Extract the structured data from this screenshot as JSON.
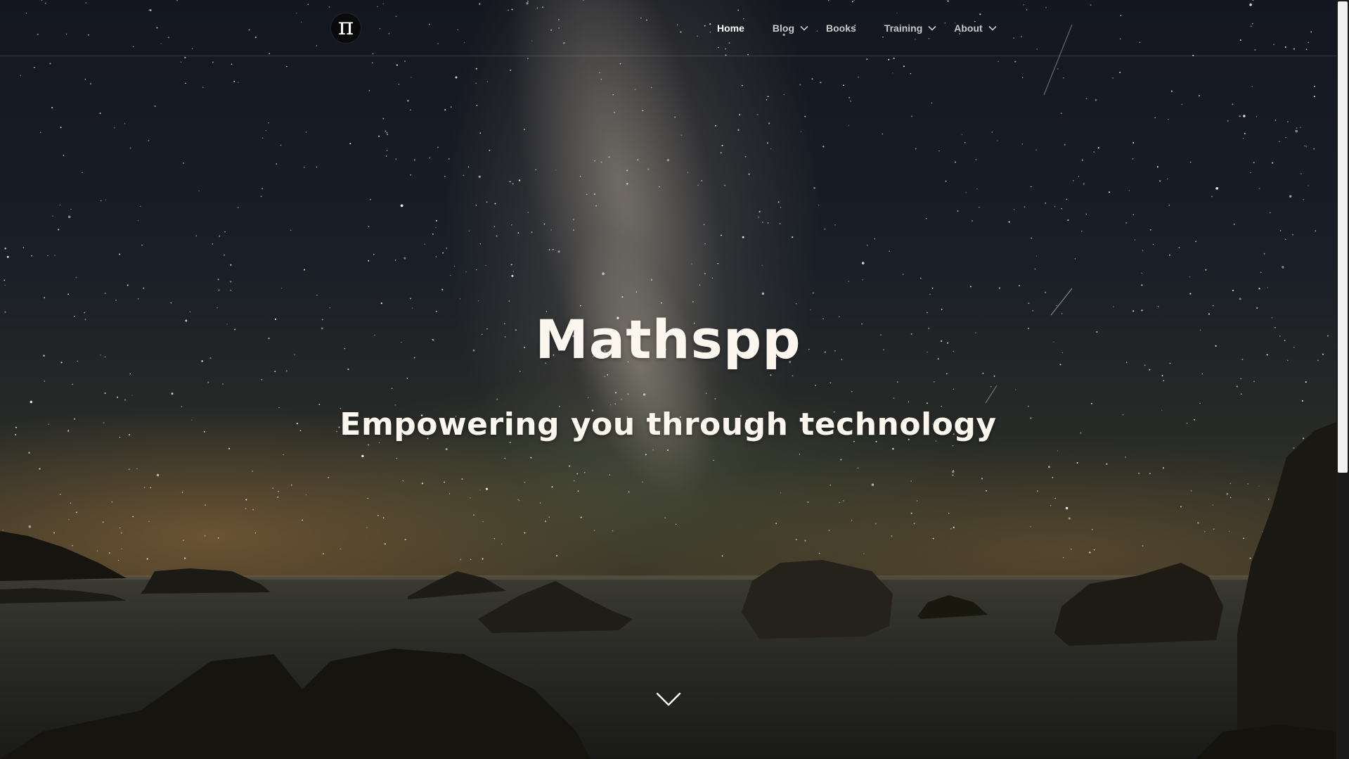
{
  "brand": {
    "logo_glyph": "π",
    "logo_icon": "pi-icon"
  },
  "nav": {
    "items": [
      {
        "label": "Home",
        "active": true,
        "has_dropdown": false
      },
      {
        "label": "Blog",
        "active": false,
        "has_dropdown": true
      },
      {
        "label": "Books",
        "active": false,
        "has_dropdown": false
      },
      {
        "label": "Training",
        "active": false,
        "has_dropdown": true
      },
      {
        "label": "About",
        "active": false,
        "has_dropdown": true
      }
    ]
  },
  "hero": {
    "title": "Mathspp",
    "subtitle": "Empowering you through technology",
    "scroll_icon": "chevron-down-icon"
  },
  "colors": {
    "hero_text": "#fbf7ee",
    "nav_active": "#ffffff",
    "nav_inactive": "#c9c9c9",
    "logo_background": "#0a0a0a"
  }
}
